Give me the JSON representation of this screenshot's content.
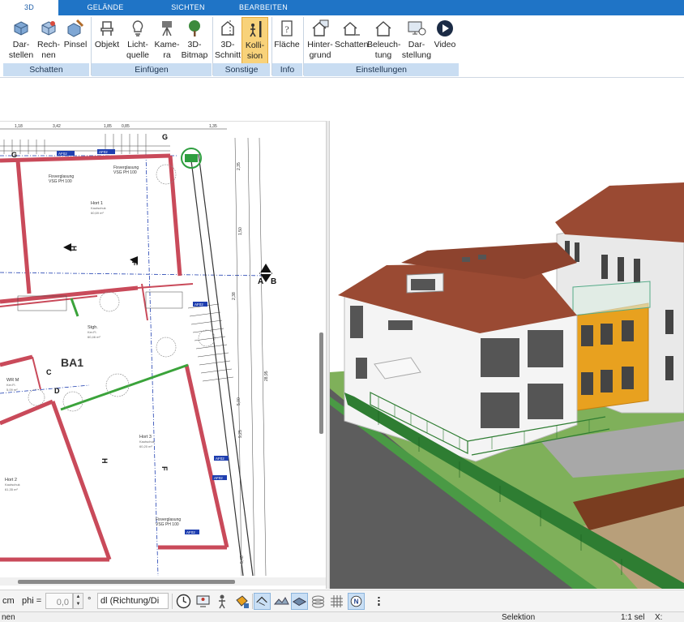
{
  "tabs": [
    {
      "label": "3D",
      "active": true
    },
    {
      "label": "GELÄNDE"
    },
    {
      "label": "SICHTEN"
    },
    {
      "label": "BEARBEITEN"
    }
  ],
  "ribbon": {
    "buttons": {
      "darstellen": "Dar-\nstellen",
      "rechnen": "Rech-\nnen",
      "pinsel": "Pinsel",
      "objekt": "Objekt",
      "lichtquelle": "Licht-\nquelle",
      "kamera": "Kame-\nra",
      "bitmap3d": "3D-\nBitmap",
      "schnitt3d": "3D-\nSchnitt",
      "kollision": "Kolli-\nsion",
      "flaeche": "Fläche",
      "hintergrund": "Hinter-\ngrund",
      "schatten": "Schatten",
      "beleuchtung": "Beleuch-\ntung",
      "darstellung": "Dar-\nstellung",
      "video": "Video"
    },
    "groups": {
      "schatten": "Schatten",
      "einfuegen": "Einfügen",
      "sonstige": "Sonstige",
      "info": "Info",
      "einstellungen": "Einstellungen"
    },
    "active_button": "Kollision"
  },
  "plan": {
    "room_label": "BA1",
    "rooms": [
      {
        "name": "Hort 1",
        "floor": "Kautschuk",
        "area": "60,69 m²"
      },
      {
        "name": "Stgh.",
        "floor": "Ker.Fl.",
        "area": "60,46 m²"
      },
      {
        "name": "WR M",
        "floor": "Ker.Fl.",
        "area": "5,09 m²"
      },
      {
        "name": "Hort 3",
        "floor": "Kautschuk",
        "area": "60,20 m²"
      },
      {
        "name": "Hort 2",
        "floor": "Kautschuk",
        "area": "61,35 m²"
      }
    ],
    "glazing_label": "Fixverglasung",
    "glazing_spec": "VSG PH 100",
    "section_marks": [
      "G",
      "H",
      "F",
      "A",
      "B",
      "C",
      "D"
    ],
    "door_tag": "AF02",
    "dimensions": [
      "3,42",
      "1,18",
      "1,85",
      "0,85",
      "1,35",
      "2,35",
      "1,50",
      "2,38",
      "28,95",
      "5,00",
      "9,25",
      "5,48"
    ]
  },
  "bottom_toolbar": {
    "unit": "cm",
    "phi_label": "phi =",
    "phi_value": "0,0",
    "degree": "°",
    "direction_select": "dl (Richtung/Di"
  },
  "status": {
    "left": "nen",
    "mode": "Selektion",
    "scale": "1:1 sel",
    "x_label": "X:"
  },
  "colors": {
    "tabbar": "#1f74c6",
    "group_label_bg": "#c9ddf2",
    "active_button_bg": "#f8d27a",
    "wall_red": "#c94a5a",
    "roof_brown": "#9a4a33",
    "facade_orange": "#e8a11f",
    "lawn_green": "#6aa84f",
    "fence_green": "#2e7d32"
  }
}
